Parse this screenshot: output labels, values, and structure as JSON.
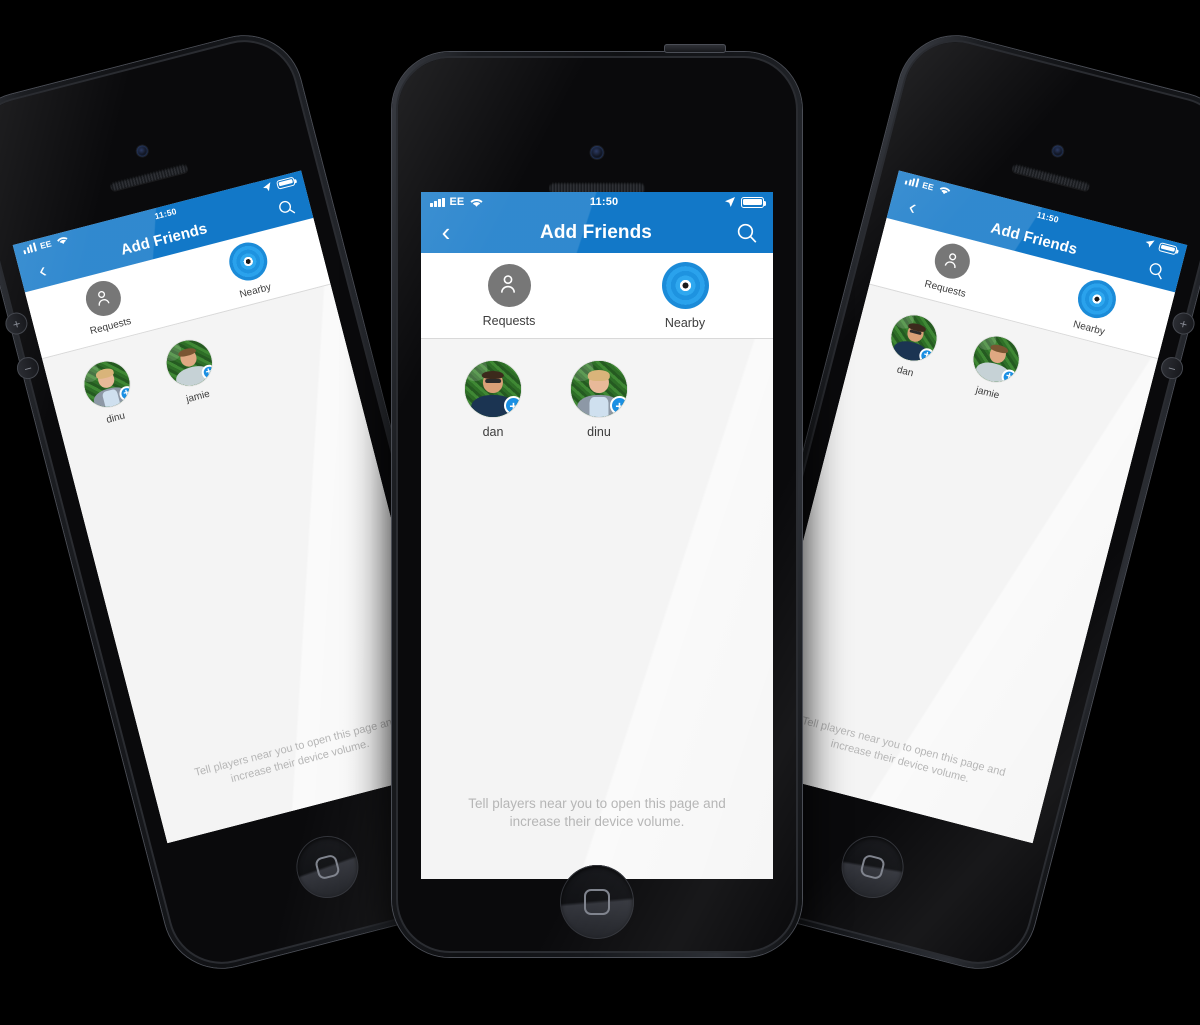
{
  "scene": {
    "background_color": "#000000",
    "device_count": 3,
    "device_model": "iPhone 5 (black)"
  },
  "app": {
    "accent_color": "#1278c8",
    "badge_color": "#1a8fe3",
    "screen_bg": "#f4f4f4",
    "statusbar": {
      "carrier": "EE",
      "time": "11:50",
      "signal_icon": "signal-bars-icon",
      "wifi_icon": "wifi-icon",
      "location_icon": "location-arrow-icon",
      "battery_icon": "battery-full-icon"
    },
    "navbar": {
      "back_icon": "chevron-left-icon",
      "title": "Add Friends",
      "search_icon": "search-icon"
    },
    "tabs": [
      {
        "label": "Requests",
        "icon": "people-icon",
        "active": false
      },
      {
        "label": "Nearby",
        "icon": "nearby-radar-icon",
        "active": true
      }
    ],
    "hint": "Tell players near you to open this page and increase their device volume.",
    "add_badge_icon": "plus-circle-icon"
  },
  "devices": [
    {
      "id": "left-phone",
      "position": "left",
      "people": [
        {
          "name": "dinu",
          "avatar": "portrait-blonde-gray-blazer"
        },
        {
          "name": "jamie",
          "avatar": "portrait-beard-light-shirt"
        }
      ]
    },
    {
      "id": "center-phone",
      "position": "center",
      "people": [
        {
          "name": "dan",
          "avatar": "portrait-glasses-navy-shirt"
        },
        {
          "name": "dinu",
          "avatar": "portrait-blonde-gray-blazer"
        }
      ]
    },
    {
      "id": "right-phone",
      "position": "right",
      "people": [
        {
          "name": "dan",
          "avatar": "portrait-glasses-navy-shirt"
        },
        {
          "name": "jamie",
          "avatar": "portrait-beard-light-shirt"
        }
      ]
    }
  ],
  "hardware": {
    "camera": "front-camera",
    "earpiece": "earpiece-speaker",
    "home_button": "home-button",
    "power_button": "power-button",
    "mute_switch": "mute-switch",
    "volume_up": "+",
    "volume_down": "−"
  }
}
